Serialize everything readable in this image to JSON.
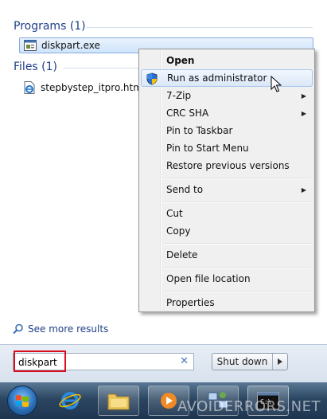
{
  "groups": {
    "programs": {
      "title": "Programs (1)",
      "items": [
        {
          "label": "diskpart.exe",
          "icon": "console-app-icon"
        }
      ]
    },
    "files": {
      "title": "Files (1)",
      "items": [
        {
          "label": "stepbystep_itpro.htm",
          "icon": "ie-document-icon"
        }
      ]
    }
  },
  "see_more": {
    "label": "See more results",
    "icon": "magnifier-icon"
  },
  "search": {
    "value": "diskpart",
    "clear_icon": "close-x-icon"
  },
  "shutdown": {
    "label": "Shut down",
    "arrow_icon": "triangle-right-icon"
  },
  "context_menu": {
    "items": [
      {
        "label": "Open",
        "bold": true
      },
      {
        "label": "Run as administrator",
        "icon": "uac-shield-icon",
        "highlighted": true
      },
      {
        "label": "7-Zip",
        "submenu": true
      },
      {
        "label": "CRC SHA",
        "submenu": true
      },
      {
        "label": "Pin to Taskbar"
      },
      {
        "label": "Pin to Start Menu"
      },
      {
        "label": "Restore previous versions"
      },
      {
        "label": "Send to",
        "submenu": true
      },
      {
        "label": "Cut"
      },
      {
        "label": "Copy"
      },
      {
        "label": "Delete"
      },
      {
        "label": "Open file location"
      },
      {
        "label": "Properties"
      }
    ],
    "submenu_glyph": "▶"
  },
  "taskbar": {
    "start_icon": "windows-orb-icon",
    "pinned": [
      "internet-explorer-icon",
      "file-explorer-icon",
      "media-player-icon",
      "network-icon",
      "command-prompt-icon"
    ],
    "watermark": "AVOIDERRORS.NET"
  },
  "colors": {
    "group_title": "#1e3f87",
    "highlight_red": "#d80e1f",
    "selection_border": "#84acdd"
  }
}
